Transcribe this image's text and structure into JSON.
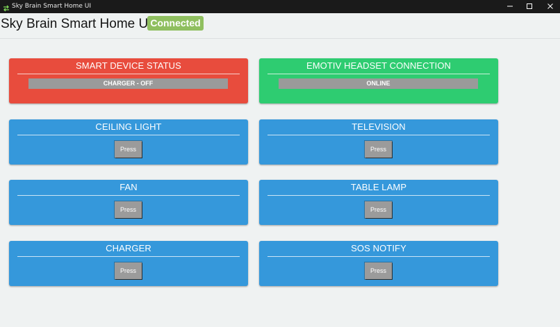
{
  "window": {
    "title": "Sky Brain Smart Home UI",
    "icon": "swap-arrows-icon",
    "controls": [
      "minimize-icon",
      "maximize-icon",
      "close-icon"
    ]
  },
  "header": {
    "app_title": "Sky Brain Smart Home UI",
    "connection_badge": "Connected"
  },
  "colors": {
    "status_red": "#e84c3d",
    "status_green": "#2ecc71",
    "device_blue": "#3598db",
    "badge_green": "#8fbf5f",
    "button_gray": "#9b9b9b"
  },
  "status_cards": [
    {
      "title": "SMART DEVICE STATUS",
      "status": "CHARGER - OFF"
    },
    {
      "title": "EMOTIV HEADSET CONNECTION",
      "status": "ONLINE"
    }
  ],
  "devices": [
    {
      "title": "CEILING LIGHT",
      "button": "Press"
    },
    {
      "title": "TELEVISION",
      "button": "Press"
    },
    {
      "title": "FAN",
      "button": "Press"
    },
    {
      "title": "TABLE LAMP",
      "button": "Press"
    },
    {
      "title": "CHARGER",
      "button": "Press"
    },
    {
      "title": "SOS NOTIFY",
      "button": "Press"
    }
  ]
}
